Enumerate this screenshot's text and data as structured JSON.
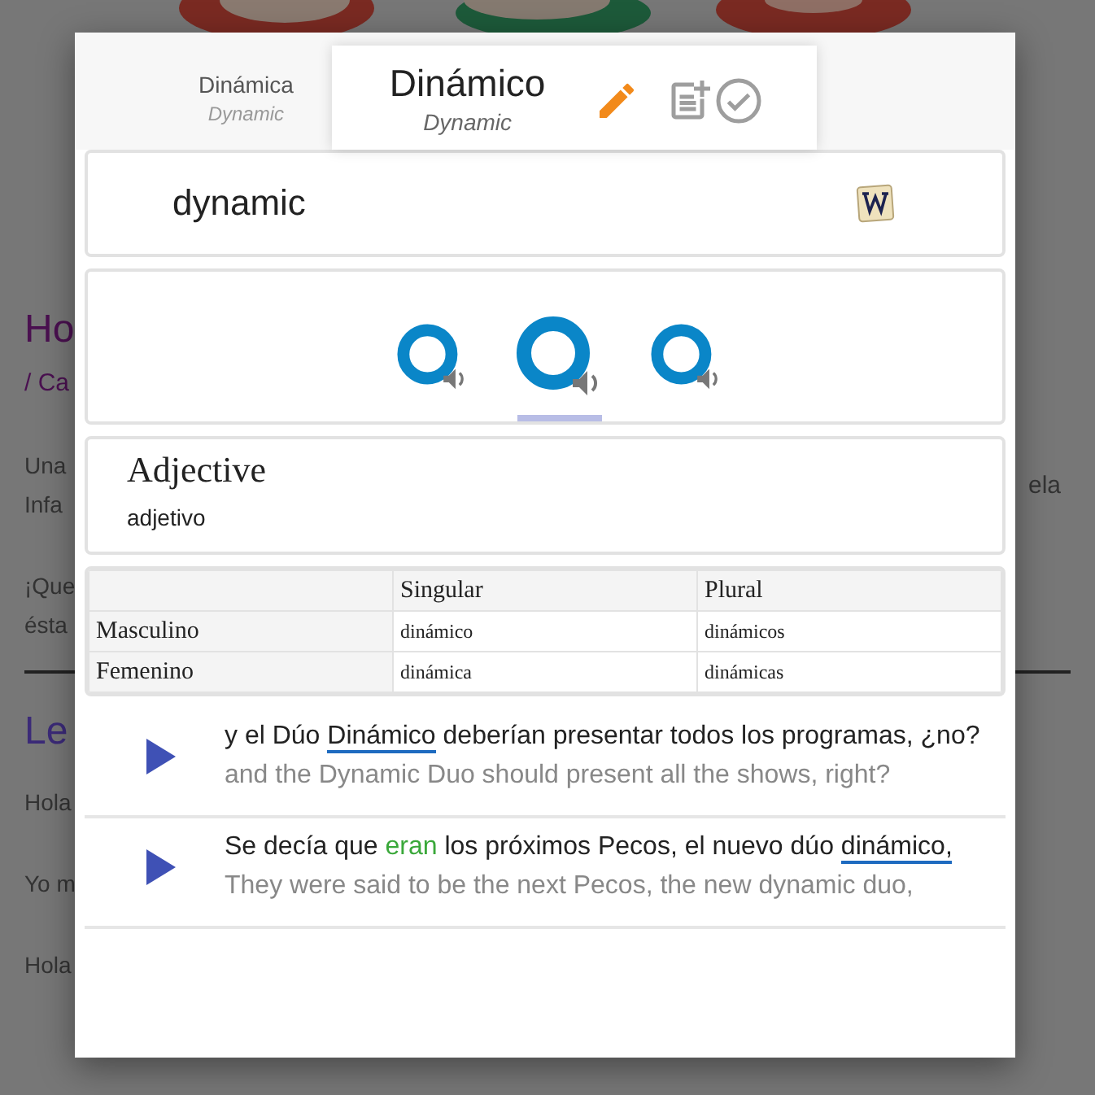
{
  "background_page": {
    "heading": "Ho",
    "breadcrumb": "/ Ca",
    "paragraph_lines": [
      "Una",
      "Infa"
    ],
    "paragraph_end": "ela",
    "question_lines": [
      "¡Que",
      "ésta"
    ],
    "section_heading": "Le",
    "lines": [
      "Hola",
      "Yo m",
      "Hola"
    ]
  },
  "modal": {
    "tabs": [
      {
        "title": "Dinámica",
        "subtitle": "Dynamic",
        "selected": false
      },
      {
        "title": "Dinámico",
        "subtitle": "Dynamic",
        "selected": true
      }
    ],
    "word": "dynamic",
    "audio": [
      {
        "selected": false
      },
      {
        "selected": true
      },
      {
        "selected": false
      }
    ],
    "part_of_speech": "Adjective",
    "part_of_speech_native": "adjetivo",
    "table": {
      "columns": [
        "Singular",
        "Plural"
      ],
      "rows": [
        {
          "label": "Masculino",
          "cells": [
            "dinámico",
            "dinámicos"
          ]
        },
        {
          "label": "Femenino",
          "cells": [
            "dinámica",
            "dinámicas"
          ]
        }
      ]
    },
    "examples": [
      {
        "segments": [
          {
            "text": "y el Dúo ",
            "kind": "plain"
          },
          {
            "text": "Dinámico",
            "kind": "keyword"
          },
          {
            "text": " deberían presentar todos los programas, ¿no?",
            "kind": "plain"
          }
        ],
        "translation": "and the Dynamic Duo should present all the shows, right?"
      },
      {
        "segments": [
          {
            "text": "Se decía que ",
            "kind": "plain"
          },
          {
            "text": "eran",
            "kind": "known"
          },
          {
            "text": " los próximos Pecos, el nuevo dúo ",
            "kind": "plain"
          },
          {
            "text": "dinámico,",
            "kind": "keyword"
          }
        ],
        "translation": "They were said to be the next Pecos, the new dynamic duo,"
      }
    ]
  }
}
